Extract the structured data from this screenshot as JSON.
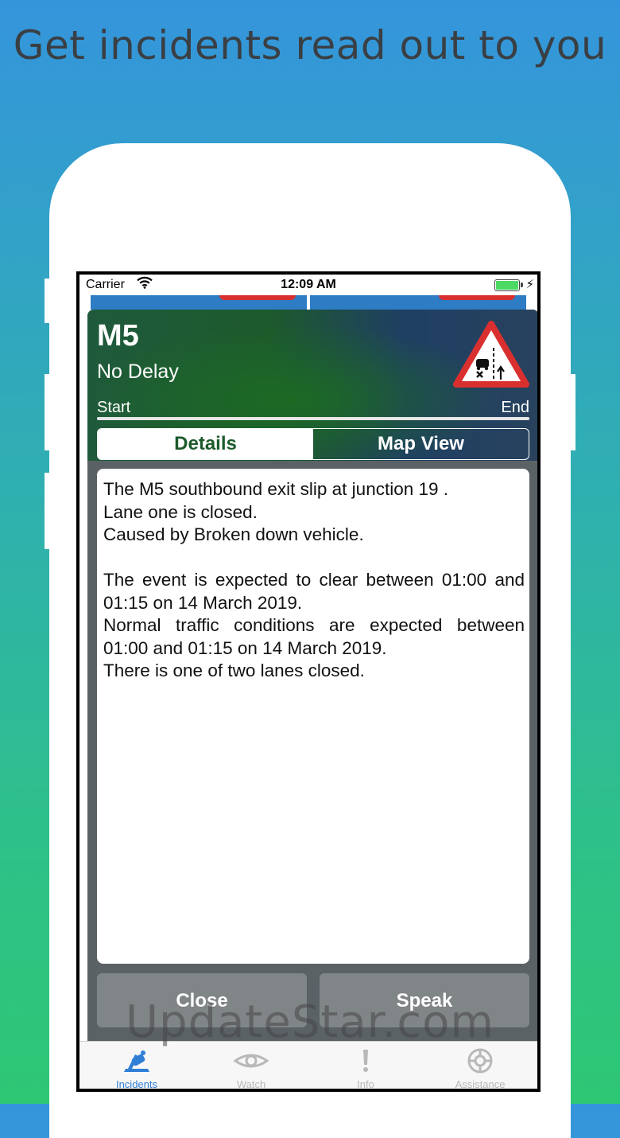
{
  "headline": "Get incidents read out to you",
  "status_bar": {
    "carrier": "Carrier",
    "time": "12:09 AM",
    "battery_level": 1.0
  },
  "incident": {
    "road": "M5",
    "delay": "No Delay",
    "start_label": "Start",
    "end_label": "End",
    "progress": 1.0
  },
  "segmented": {
    "details": "Details",
    "map_view": "Map View",
    "selected": "details"
  },
  "details": {
    "lines": [
      "The M5 southbound exit slip at junction 19 .",
      "Lane one is closed.",
      "Caused by Broken down vehicle.",
      "",
      "The event is expected to clear between 01:00 and 01:15 on 14 March 2019.",
      "Normal traffic conditions are expected between 01:00 and 01:15 on 14 March 2019.",
      "There is one of two lanes closed."
    ]
  },
  "buttons": {
    "close": "Close",
    "speak": "Speak"
  },
  "tabbar": {
    "items": [
      {
        "label": "Incidents",
        "icon": "incident-car-icon",
        "active": true
      },
      {
        "label": "Watch",
        "icon": "eye-icon",
        "active": false
      },
      {
        "label": "Info",
        "icon": "exclamation-icon",
        "active": false
      },
      {
        "label": "Assistance",
        "icon": "lifebuoy-icon",
        "active": false
      }
    ]
  },
  "watermark": "UpdateStar.com",
  "colors": {
    "tab_active": "#2f7fd6",
    "tab_inactive": "#b8b8b8",
    "header_green": "#1d5a2c",
    "sign_red": "#d9302f"
  }
}
